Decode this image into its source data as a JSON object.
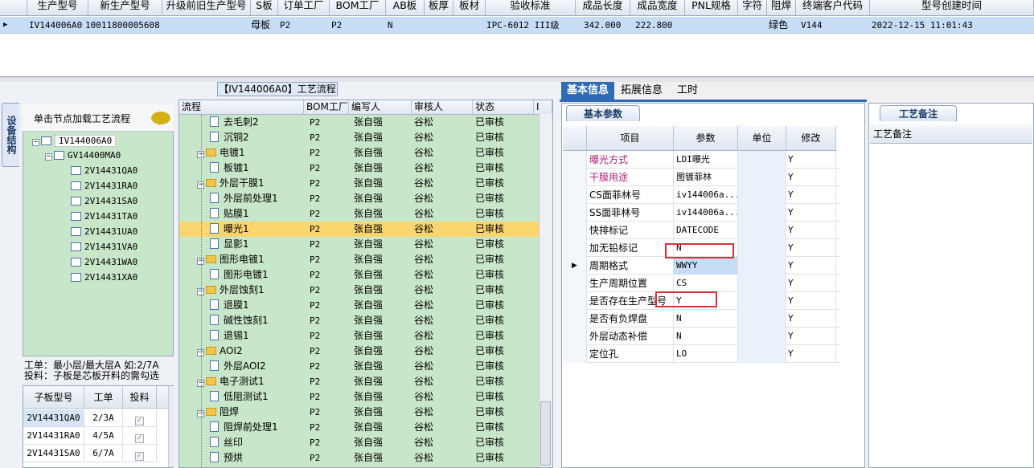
{
  "top_grid": {
    "columns": [
      "生产型号",
      "新生产型号",
      "升级前旧生产型号",
      "S板",
      "订单工厂",
      "BOM工厂",
      "AB板",
      "板厚",
      "板材",
      "验收标准",
      "成品长度",
      "成品宽度",
      "PNL规格",
      "字符",
      "阻焊",
      "终端客户代码",
      "型号创建时间"
    ],
    "row": {
      "prod_model": "IV144006A0",
      "new_model": "10011800005608",
      "board_type": "母板",
      "order_factory": "P2",
      "bom_factory": "P2",
      "ab_board": "N",
      "standard": "IPC-6012 III级",
      "length": "342.000",
      "width": "222.800",
      "solder": "绿色",
      "customer": "V144",
      "created": "2022-12-15 11:01:43"
    }
  },
  "process_group_caption": "【IV144006A0】工艺流程",
  "left_tab": "设备结构",
  "tree": {
    "header": "单击节点加载工艺流程",
    "root": "IV144006A0",
    "child": "GV14400MA0",
    "leaves": [
      "2V14431QA0",
      "2V14431RA0",
      "2V14431SA0",
      "2V14431TA0",
      "2V14431UA0",
      "2V14431VA0",
      "2V14431WA0",
      "2V14431XA0"
    ]
  },
  "note_line1": "工单：最小层/最大层A 如:2/7A",
  "note_line2": "投料：子板是芯板开料的需勾选",
  "sub_grid": {
    "headers": [
      "子板型号",
      "工单",
      "投料"
    ],
    "rows": [
      {
        "model": "2V14431QA0",
        "order": "2/3A"
      },
      {
        "model": "2V14431RA0",
        "order": "4/5A"
      },
      {
        "model": "2V14431SA0",
        "order": "6/7A"
      }
    ]
  },
  "process_grid": {
    "headers": [
      "流程",
      "BOM工厂",
      "编写人",
      "审核人",
      "状态",
      "I"
    ],
    "rows": [
      {
        "name": "去毛刺2",
        "folder": false,
        "factory": "P2",
        "writer": "张自强",
        "auditor": "谷松",
        "status": "已审核"
      },
      {
        "name": "沉铜2",
        "folder": false,
        "factory": "P2",
        "writer": "张自强",
        "auditor": "谷松",
        "status": "已审核"
      },
      {
        "name": "电镀1",
        "folder": true,
        "factory": "P2",
        "writer": "张自强",
        "auditor": "谷松",
        "status": "已审核"
      },
      {
        "name": "板镀1",
        "folder": false,
        "factory": "P2",
        "writer": "张自强",
        "auditor": "谷松",
        "status": "已审核"
      },
      {
        "name": "外层干膜1",
        "folder": true,
        "factory": "P2",
        "writer": "张自强",
        "auditor": "谷松",
        "status": "已审核"
      },
      {
        "name": "外层前处理1",
        "folder": false,
        "factory": "P2",
        "writer": "张自强",
        "auditor": "谷松",
        "status": "已审核"
      },
      {
        "name": "贴膜1",
        "folder": false,
        "factory": "P2",
        "writer": "张自强",
        "auditor": "谷松",
        "status": "已审核"
      },
      {
        "name": "曝光1",
        "folder": false,
        "factory": "P2",
        "writer": "张自强",
        "auditor": "谷松",
        "status": "已审核",
        "selected": true
      },
      {
        "name": "显影1",
        "folder": false,
        "factory": "P2",
        "writer": "张自强",
        "auditor": "谷松",
        "status": "已审核"
      },
      {
        "name": "图形电镀1",
        "folder": true,
        "factory": "P2",
        "writer": "张自强",
        "auditor": "谷松",
        "status": "已审核"
      },
      {
        "name": "图形电镀1",
        "folder": false,
        "factory": "P2",
        "writer": "张自强",
        "auditor": "谷松",
        "status": "已审核"
      },
      {
        "name": "外层蚀刻1",
        "folder": true,
        "factory": "P2",
        "writer": "张自强",
        "auditor": "谷松",
        "status": "已审核"
      },
      {
        "name": "退膜1",
        "folder": false,
        "factory": "P2",
        "writer": "张自强",
        "auditor": "谷松",
        "status": "已审核"
      },
      {
        "name": "碱性蚀刻1",
        "folder": false,
        "factory": "P2",
        "writer": "张自强",
        "auditor": "谷松",
        "status": "已审核"
      },
      {
        "name": "退锡1",
        "folder": false,
        "factory": "P2",
        "writer": "张自强",
        "auditor": "谷松",
        "status": "已审核"
      },
      {
        "name": "AOI2",
        "folder": true,
        "factory": "P2",
        "writer": "张自强",
        "auditor": "谷松",
        "status": "已审核"
      },
      {
        "name": "外层AOI2",
        "folder": false,
        "factory": "P2",
        "writer": "张自强",
        "auditor": "谷松",
        "status": "已审核"
      },
      {
        "name": "电子测试1",
        "folder": true,
        "factory": "P2",
        "writer": "张自强",
        "auditor": "谷松",
        "status": "已审核"
      },
      {
        "name": "低阻测试1",
        "folder": false,
        "factory": "P2",
        "writer": "张自强",
        "auditor": "谷松",
        "status": "已审核"
      },
      {
        "name": "阻焊",
        "folder": true,
        "factory": "P2",
        "writer": "张自强",
        "auditor": "谷松",
        "status": "已审核"
      },
      {
        "name": "阻焊前处理1",
        "folder": false,
        "factory": "P2",
        "writer": "张自强",
        "auditor": "谷松",
        "status": "已审核"
      },
      {
        "name": "丝印",
        "folder": false,
        "factory": "P2",
        "writer": "张自强",
        "auditor": "谷松",
        "status": "已审核"
      },
      {
        "name": "预烘",
        "folder": false,
        "factory": "P2",
        "writer": "张自强",
        "auditor": "谷松",
        "status": "已审核"
      }
    ]
  },
  "tabs": [
    "基本信息",
    "拓展信息",
    "工时"
  ],
  "basic_params": {
    "tab": "基本参数",
    "headers": [
      "项目",
      "参数",
      "单位",
      "修改"
    ],
    "rows": [
      {
        "item": "曝光方式",
        "value": "LDI曝光",
        "unit": "",
        "edit": "Y",
        "color": "#b0207a"
      },
      {
        "item": "干膜用途",
        "value": "图镀菲林",
        "unit": "",
        "edit": "Y",
        "color": "#b0207a"
      },
      {
        "item": "CS面菲林号",
        "value": "iv144006a...",
        "unit": "",
        "edit": "Y",
        "color": "#000000"
      },
      {
        "item": "SS面菲林号",
        "value": "iv144006a...",
        "unit": "",
        "edit": "Y",
        "color": "#000000"
      },
      {
        "item": "快排标记",
        "value": "DATECODE",
        "unit": "",
        "edit": "Y",
        "color": "#000000"
      },
      {
        "item": "加无铅标记",
        "value": "N",
        "unit": "",
        "edit": "Y",
        "color": "#000000"
      },
      {
        "item": "周期格式",
        "value": "WWYY",
        "unit": "",
        "edit": "Y",
        "color": "#000000",
        "current": true
      },
      {
        "item": "生产周期位置",
        "value": "CS",
        "unit": "",
        "edit": "Y",
        "color": "#000000"
      },
      {
        "item": "是否存在生产型号",
        "value": "Y",
        "unit": "",
        "edit": "Y",
        "color": "#000000"
      },
      {
        "item": "是否有负焊盘",
        "value": "N",
        "unit": "",
        "edit": "Y",
        "color": "#000000"
      },
      {
        "item": "外层动态补偿",
        "value": "N",
        "unit": "",
        "edit": "Y",
        "color": "#000000"
      },
      {
        "item": "定位孔",
        "value": "LO",
        "unit": "",
        "edit": "Y",
        "color": "#000000"
      }
    ]
  },
  "process_notes": {
    "tab": "工艺备注",
    "header": "工艺备注"
  },
  "colors": {
    "accent": "#2f6bb5",
    "tree_bg": "#c8e6c9",
    "selected_row": "#fbd56e",
    "highlight_box": "#d6323a"
  }
}
